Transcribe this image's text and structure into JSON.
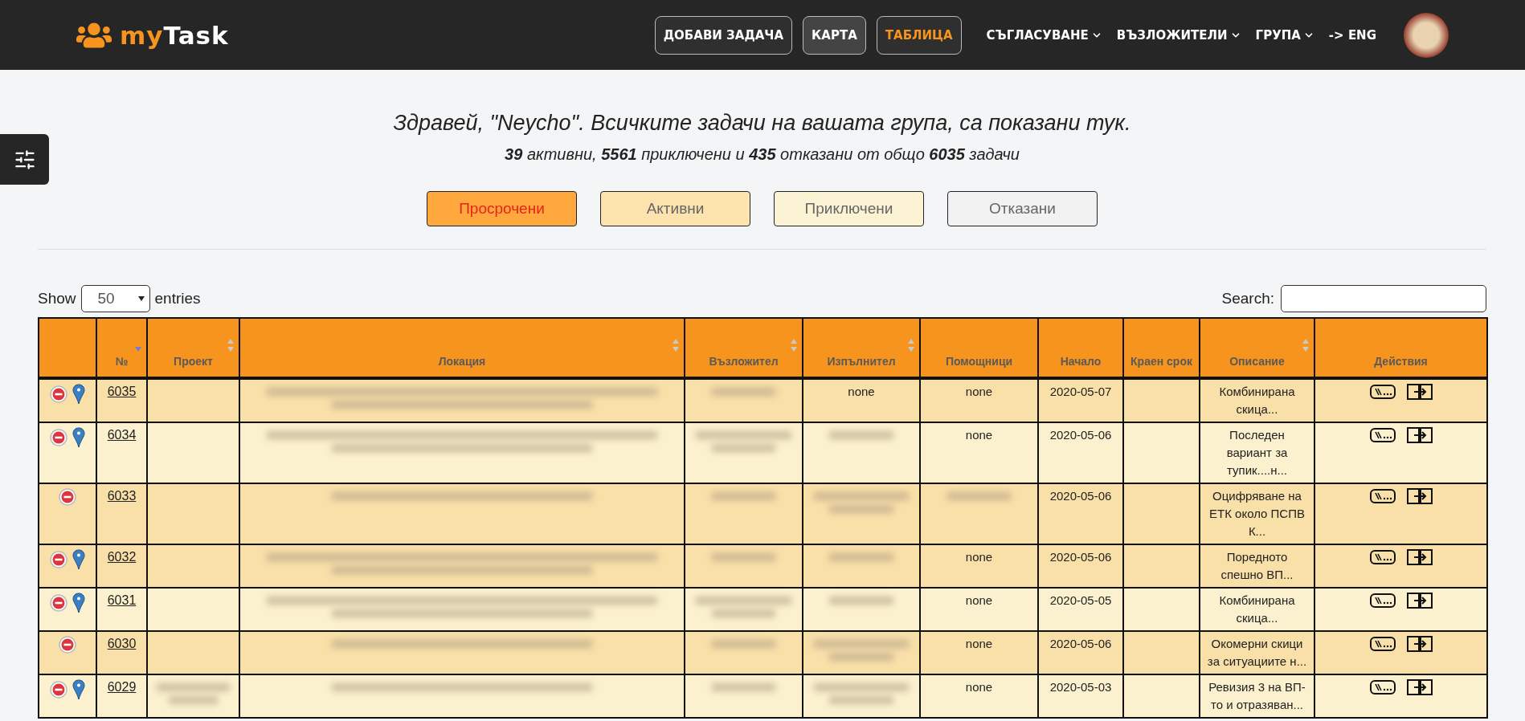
{
  "header": {
    "logo": {
      "first": "my",
      "second": "Task"
    },
    "nav_buttons": [
      {
        "label": "ДОБАВИ ЗАДАЧА",
        "selected": false
      },
      {
        "label": "КАРТА",
        "selected": false
      },
      {
        "label": "ТАБЛИЦА",
        "selected": true
      }
    ],
    "menus": [
      {
        "label": "СЪГЛАСУВАНЕ",
        "kind": "dropdown"
      },
      {
        "label": "ВЪЗЛОЖИТЕЛИ",
        "kind": "dropdown"
      },
      {
        "label": "ГРУПА",
        "kind": "dropdown"
      },
      {
        "label": "-> ENG",
        "kind": "link"
      }
    ]
  },
  "greeting": "Здравей, \"Neycho\". Всичките задачи на вашата група, са показани тук.",
  "summary": "**39** активни, **5561** приключени и **435** отказани от общо **6035** задачи",
  "filters": [
    {
      "label": "Просрочени",
      "selected": true,
      "color": "#ffa83e"
    },
    {
      "label": "Активни",
      "selected": false,
      "color": "#fde3ad"
    },
    {
      "label": "Приключени",
      "selected": false,
      "color": "#fcf3d4"
    },
    {
      "label": "Отказани",
      "selected": false,
      "color": "#f2f2f2"
    }
  ],
  "table": {
    "show_label": "Show",
    "length": "50",
    "entries_label": "entries",
    "search_label": "Search:",
    "columns": [
      {
        "sortable": false
      },
      {
        "label": "№",
        "sortable": true,
        "sorted": true
      },
      {
        "label": "Проект",
        "sortable": true,
        "sorted": false
      },
      {
        "label": "Локация",
        "sortable": true,
        "sorted": false
      },
      {
        "label": "Възложител",
        "sortable": true,
        "sorted": false
      },
      {
        "label": "Изпълнител",
        "sortable": true,
        "sorted": false
      },
      {
        "label": "Помощници",
        "sortable": false
      },
      {
        "label": "Начало",
        "sortable": false
      },
      {
        "label": "Краен срок",
        "sortable": false
      },
      {
        "label": "Описание",
        "sortable": true,
        "sorted": false
      },
      {
        "label": "Действия",
        "sortable": false
      }
    ],
    "rows": [
      {
        "color": "#f9dfa8",
        "cells": [
          {
            "kind": "icons",
            "map_pin": true
          },
          {
            "kind": "link",
            "text": "6035"
          },
          {
            "kind": "empty"
          },
          {
            "kind": "blurred",
            "wrap": true
          },
          {
            "kind": "blurred_link",
            "wrap": false
          },
          {
            "kind": "text",
            "text": "none"
          },
          {
            "kind": "text",
            "text": "none"
          },
          {
            "kind": "text",
            "text": "2020-05-07"
          },
          {
            "kind": "empty"
          },
          {
            "kind": "text",
            "text": "Комбинирана скица..."
          },
          {
            "kind": "actions"
          }
        ]
      },
      {
        "color": "#fbf1cf",
        "cells": [
          {
            "kind": "icons",
            "map_pin": true
          },
          {
            "kind": "link",
            "text": "6034"
          },
          {
            "kind": "empty"
          },
          {
            "kind": "blurred",
            "wrap": true
          },
          {
            "kind": "blurred_link",
            "wrap": true
          },
          {
            "kind": "blurred",
            "wrap": false
          },
          {
            "kind": "text",
            "text": "none"
          },
          {
            "kind": "text",
            "text": "2020-05-06"
          },
          {
            "kind": "empty"
          },
          {
            "kind": "text",
            "text": "Последен вариант за тупик....н..."
          },
          {
            "kind": "actions"
          }
        ]
      },
      {
        "color": "#f9dfa8",
        "cells": [
          {
            "kind": "icons",
            "map_pin": false
          },
          {
            "kind": "link",
            "text": "6033"
          },
          {
            "kind": "empty"
          },
          {
            "kind": "blurred",
            "wrap": false
          },
          {
            "kind": "blurred_link",
            "wrap": false
          },
          {
            "kind": "blurred",
            "wrap": true
          },
          {
            "kind": "blurred",
            "wrap": false
          },
          {
            "kind": "text",
            "text": "2020-05-06"
          },
          {
            "kind": "empty"
          },
          {
            "kind": "text",
            "text": "Оцифряване на ЕТК около ПСПВ К..."
          },
          {
            "kind": "actions"
          }
        ]
      },
      {
        "color": "#f9dfa8",
        "cells": [
          {
            "kind": "icons",
            "map_pin": true
          },
          {
            "kind": "link",
            "text": "6032"
          },
          {
            "kind": "empty"
          },
          {
            "kind": "blurred",
            "wrap": true
          },
          {
            "kind": "blurred_link",
            "wrap": false
          },
          {
            "kind": "blurred",
            "wrap": false
          },
          {
            "kind": "text",
            "text": "none"
          },
          {
            "kind": "text",
            "text": "2020-05-06"
          },
          {
            "kind": "empty"
          },
          {
            "kind": "text",
            "text": "Поредното спешно ВП..."
          },
          {
            "kind": "actions"
          }
        ]
      },
      {
        "color": "#fbf1cf",
        "cells": [
          {
            "kind": "icons",
            "map_pin": true
          },
          {
            "kind": "link",
            "text": "6031"
          },
          {
            "kind": "empty"
          },
          {
            "kind": "blurred",
            "wrap": true
          },
          {
            "kind": "blurred_link",
            "wrap": true
          },
          {
            "kind": "blurred",
            "wrap": false
          },
          {
            "kind": "text",
            "text": "none"
          },
          {
            "kind": "text",
            "text": "2020-05-05"
          },
          {
            "kind": "empty"
          },
          {
            "kind": "text",
            "text": "Комбинирана скица..."
          },
          {
            "kind": "actions"
          }
        ]
      },
      {
        "color": "#f9dfa8",
        "cells": [
          {
            "kind": "icons",
            "map_pin": false
          },
          {
            "kind": "link",
            "text": "6030"
          },
          {
            "kind": "empty"
          },
          {
            "kind": "blurred",
            "wrap": false
          },
          {
            "kind": "blurred_link",
            "wrap": false
          },
          {
            "kind": "blurred",
            "wrap": true
          },
          {
            "kind": "text",
            "text": "none"
          },
          {
            "kind": "text",
            "text": "2020-05-06"
          },
          {
            "kind": "empty"
          },
          {
            "kind": "text",
            "text": "Окомерни скици за ситуациите н..."
          },
          {
            "kind": "actions"
          }
        ]
      },
      {
        "color": "#fbf1cf",
        "cells": [
          {
            "kind": "icons",
            "map_pin": true
          },
          {
            "kind": "link",
            "text": "6029"
          },
          {
            "kind": "blurred_link",
            "wrap": true
          },
          {
            "kind": "blurred",
            "wrap": false
          },
          {
            "kind": "blurred_link",
            "wrap": false
          },
          {
            "kind": "blurred",
            "wrap": true
          },
          {
            "kind": "text",
            "text": "none"
          },
          {
            "kind": "text",
            "text": "2020-05-03"
          },
          {
            "kind": "empty"
          },
          {
            "kind": "text",
            "text": "Ревизия 3 на ВП-то и отразяван..."
          },
          {
            "kind": "actions"
          }
        ]
      }
    ]
  }
}
